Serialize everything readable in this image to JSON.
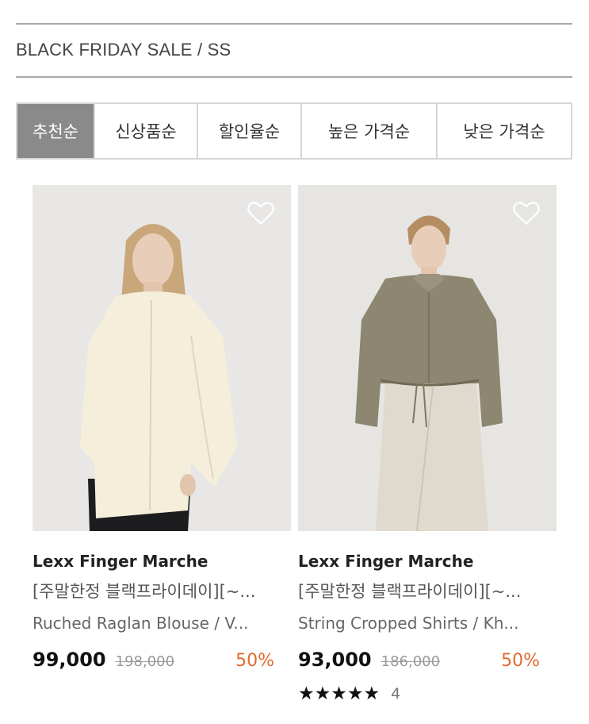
{
  "header": {
    "title": "BLACK FRIDAY SALE / SS"
  },
  "sort_tabs": [
    {
      "label": "추천순",
      "active": true
    },
    {
      "label": "신상품순",
      "active": false
    },
    {
      "label": "할인율순",
      "active": false
    },
    {
      "label": "높은 가격순",
      "active": false
    },
    {
      "label": "낮은 가격순",
      "active": false
    }
  ],
  "products": [
    {
      "brand": "Lexx Finger Marche",
      "subtitle": "[주말한정 블랙프라이데이][~...",
      "name": "Ruched Raglan Blouse / V...",
      "price": "99,000",
      "original_price": "198,000",
      "discount": "50%",
      "image_icon": "model-cream-blouse"
    },
    {
      "brand": "Lexx Finger Marche",
      "subtitle": "[주말한정 블랙프라이데이][~...",
      "name": "String Cropped Shirts / Kh...",
      "price": "93,000",
      "original_price": "186,000",
      "discount": "50%",
      "stars": "★★★★★",
      "review_count": "4",
      "image_icon": "model-khaki-shirt"
    }
  ],
  "colors": {
    "active_tab": "#8a8a8a",
    "discount": "#e26a2c"
  }
}
